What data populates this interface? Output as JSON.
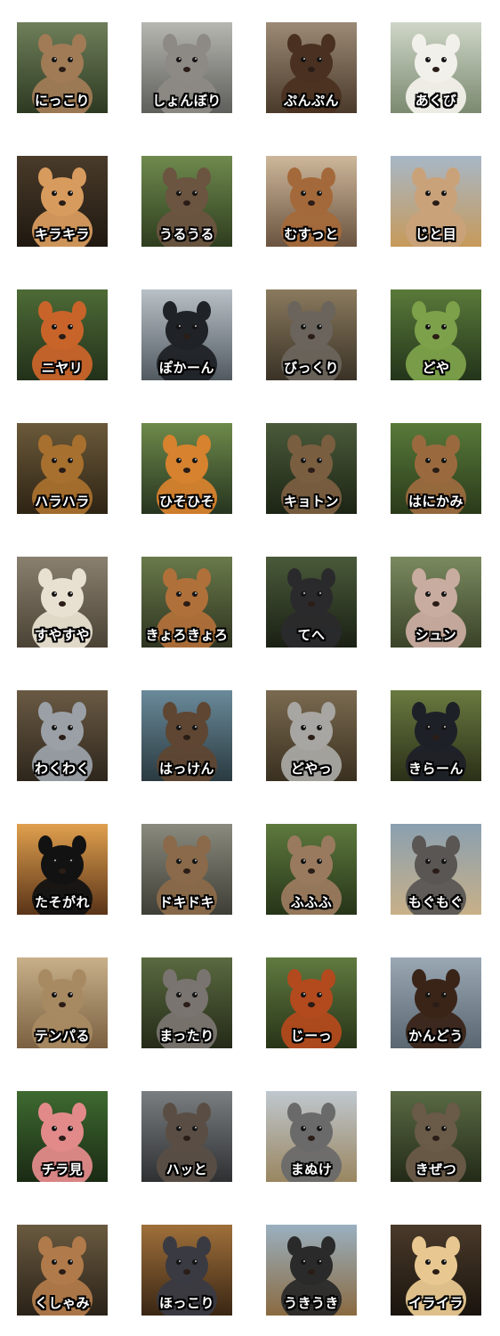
{
  "stickers": [
    {
      "label": "にっこり",
      "animal": "cat",
      "bg": [
        "#6f7f5a",
        "#2d3a22"
      ],
      "fur": "#a07b56"
    },
    {
      "label": "しょんぼり",
      "animal": "rabbit",
      "bg": [
        "#b7b7b2",
        "#5e5e5a"
      ],
      "fur": "#8d8a85"
    },
    {
      "label": "ぷんぷん",
      "animal": "bear",
      "bg": [
        "#9c8a76",
        "#4a3a2a"
      ],
      "fur": "#4a3020"
    },
    {
      "label": "あくび",
      "animal": "panda",
      "bg": [
        "#cfd6c8",
        "#7b8a70"
      ],
      "fur": "#f2f0ea"
    },
    {
      "label": "キラキラ",
      "animal": "hamster",
      "bg": [
        "#4a3b2a",
        "#1f1810"
      ],
      "fur": "#d79b5e"
    },
    {
      "label": "うるうる",
      "animal": "otter",
      "bg": [
        "#6f8a4e",
        "#2e3d1e"
      ],
      "fur": "#6b5440"
    },
    {
      "label": "むすっと",
      "animal": "dog",
      "bg": [
        "#cdb79a",
        "#6b5440"
      ],
      "fur": "#a4693a"
    },
    {
      "label": "じと目",
      "animal": "alpaca",
      "bg": [
        "#a7b7c7",
        "#c79a5a"
      ],
      "fur": "#c9a27a"
    },
    {
      "label": "ニヤリ",
      "animal": "fox",
      "bg": [
        "#4e6b36",
        "#22301a"
      ],
      "fur": "#c8642a"
    },
    {
      "label": "ぽかーん",
      "animal": "penguin",
      "bg": [
        "#b9c1c7",
        "#515a60"
      ],
      "fur": "#1f2226"
    },
    {
      "label": "びっくり",
      "animal": "elephant",
      "bg": [
        "#8a7a5e",
        "#3a3226"
      ],
      "fur": "#6a645c"
    },
    {
      "label": "どや",
      "animal": "frog",
      "bg": [
        "#5a7a3a",
        "#23341a"
      ],
      "fur": "#7ca14a"
    },
    {
      "label": "ハラハラ",
      "animal": "lion",
      "bg": [
        "#6b5a3a",
        "#2e2314"
      ],
      "fur": "#a8702e"
    },
    {
      "label": "ひそひそ",
      "animal": "tiger",
      "bg": [
        "#6e8a4a",
        "#263420"
      ],
      "fur": "#d6822e"
    },
    {
      "label": "キョトン",
      "animal": "owl",
      "bg": [
        "#4a5a3a",
        "#1c2414"
      ],
      "fur": "#7a5e40"
    },
    {
      "label": "はにかみ",
      "animal": "capybara",
      "bg": [
        "#587a3a",
        "#2a3a1a"
      ],
      "fur": "#9a6a3e"
    },
    {
      "label": "すやすや",
      "animal": "sheep",
      "bg": [
        "#8a8070",
        "#4a4234"
      ],
      "fur": "#e8e0d0"
    },
    {
      "label": "きょろきょろ",
      "animal": "squirrel",
      "bg": [
        "#6a7a4a",
        "#2e3420"
      ],
      "fur": "#b0703a"
    },
    {
      "label": "てへ",
      "animal": "gorilla",
      "bg": [
        "#4a5a3a",
        "#1a2014"
      ],
      "fur": "#2a2a2c"
    },
    {
      "label": "シュン",
      "animal": "pig",
      "bg": [
        "#7a8a60",
        "#3a4228"
      ],
      "fur": "#c9aca0"
    },
    {
      "label": "わくわく",
      "animal": "chinchilla",
      "bg": [
        "#6a5a44",
        "#2e261c"
      ],
      "fur": "#9aa0a6"
    },
    {
      "label": "はっけん",
      "animal": "otter",
      "bg": [
        "#6a8a9a",
        "#2a3a40"
      ],
      "fur": "#5e4632"
    },
    {
      "label": "どやっ",
      "animal": "koala",
      "bg": [
        "#7a6a50",
        "#3a3020"
      ],
      "fur": "#a8a6a2"
    },
    {
      "label": "きらーん",
      "animal": "rooster",
      "bg": [
        "#6a7a40",
        "#2a3018"
      ],
      "fur": "#1e2028"
    },
    {
      "label": "たそがれ",
      "animal": "monkey",
      "bg": [
        "#e0a04e",
        "#5a3418"
      ],
      "fur": "#121212"
    },
    {
      "label": "ドキドキ",
      "animal": "deer",
      "bg": [
        "#8a8a7e",
        "#3e3e36"
      ],
      "fur": "#8a6a4a"
    },
    {
      "label": "ふふふ",
      "animal": "ferret",
      "bg": [
        "#5e7a3e",
        "#263418"
      ],
      "fur": "#9a7a5e"
    },
    {
      "label": "もぐもぐ",
      "animal": "seal",
      "bg": [
        "#8aa0b0",
        "#c8b088"
      ],
      "fur": "#5a5654"
    },
    {
      "label": "テンパる",
      "animal": "meerkat",
      "bg": [
        "#c8b08a",
        "#7a6040"
      ],
      "fur": "#a88a62"
    },
    {
      "label": "まったり",
      "animal": "raccoon",
      "bg": [
        "#5a6a40",
        "#242a18"
      ],
      "fur": "#7a7470"
    },
    {
      "label": "じーっ",
      "animal": "red-panda",
      "bg": [
        "#607a40",
        "#283418"
      ],
      "fur": "#b24a1e"
    },
    {
      "label": "かんどう",
      "animal": "horse",
      "bg": [
        "#9aa8b4",
        "#5a6670"
      ],
      "fur": "#3a2418"
    },
    {
      "label": "チラ見",
      "animal": "flamingo",
      "bg": [
        "#3e6a30",
        "#1a2a14"
      ],
      "fur": "#e28a8a"
    },
    {
      "label": "ハッと",
      "animal": "wolf",
      "bg": [
        "#7a7e80",
        "#2e3032"
      ],
      "fur": "#5a4e44"
    },
    {
      "label": "まぬけ",
      "animal": "ostrich",
      "bg": [
        "#bfc8cf",
        "#9a8660"
      ],
      "fur": "#6a6a6a"
    },
    {
      "label": "きぜつ",
      "animal": "hedgehog",
      "bg": [
        "#5a6a44",
        "#232a18"
      ],
      "fur": "#6a5a48"
    },
    {
      "label": "くしゃみ",
      "animal": "chipmunk",
      "bg": [
        "#6a5a40",
        "#2a2218"
      ],
      "fur": "#b07a4a"
    },
    {
      "label": "ほっこり",
      "animal": "mouse",
      "bg": [
        "#a0703a",
        "#3a2614"
      ],
      "fur": "#3a3a42"
    },
    {
      "label": "うきうき",
      "animal": "sloth-bear",
      "bg": [
        "#9ab0c0",
        "#8a6a40"
      ],
      "fur": "#2a2a2a"
    },
    {
      "label": "イライラ",
      "animal": "chick",
      "bg": [
        "#4a3a2a",
        "#1a140e"
      ],
      "fur": "#e8c890"
    }
  ]
}
